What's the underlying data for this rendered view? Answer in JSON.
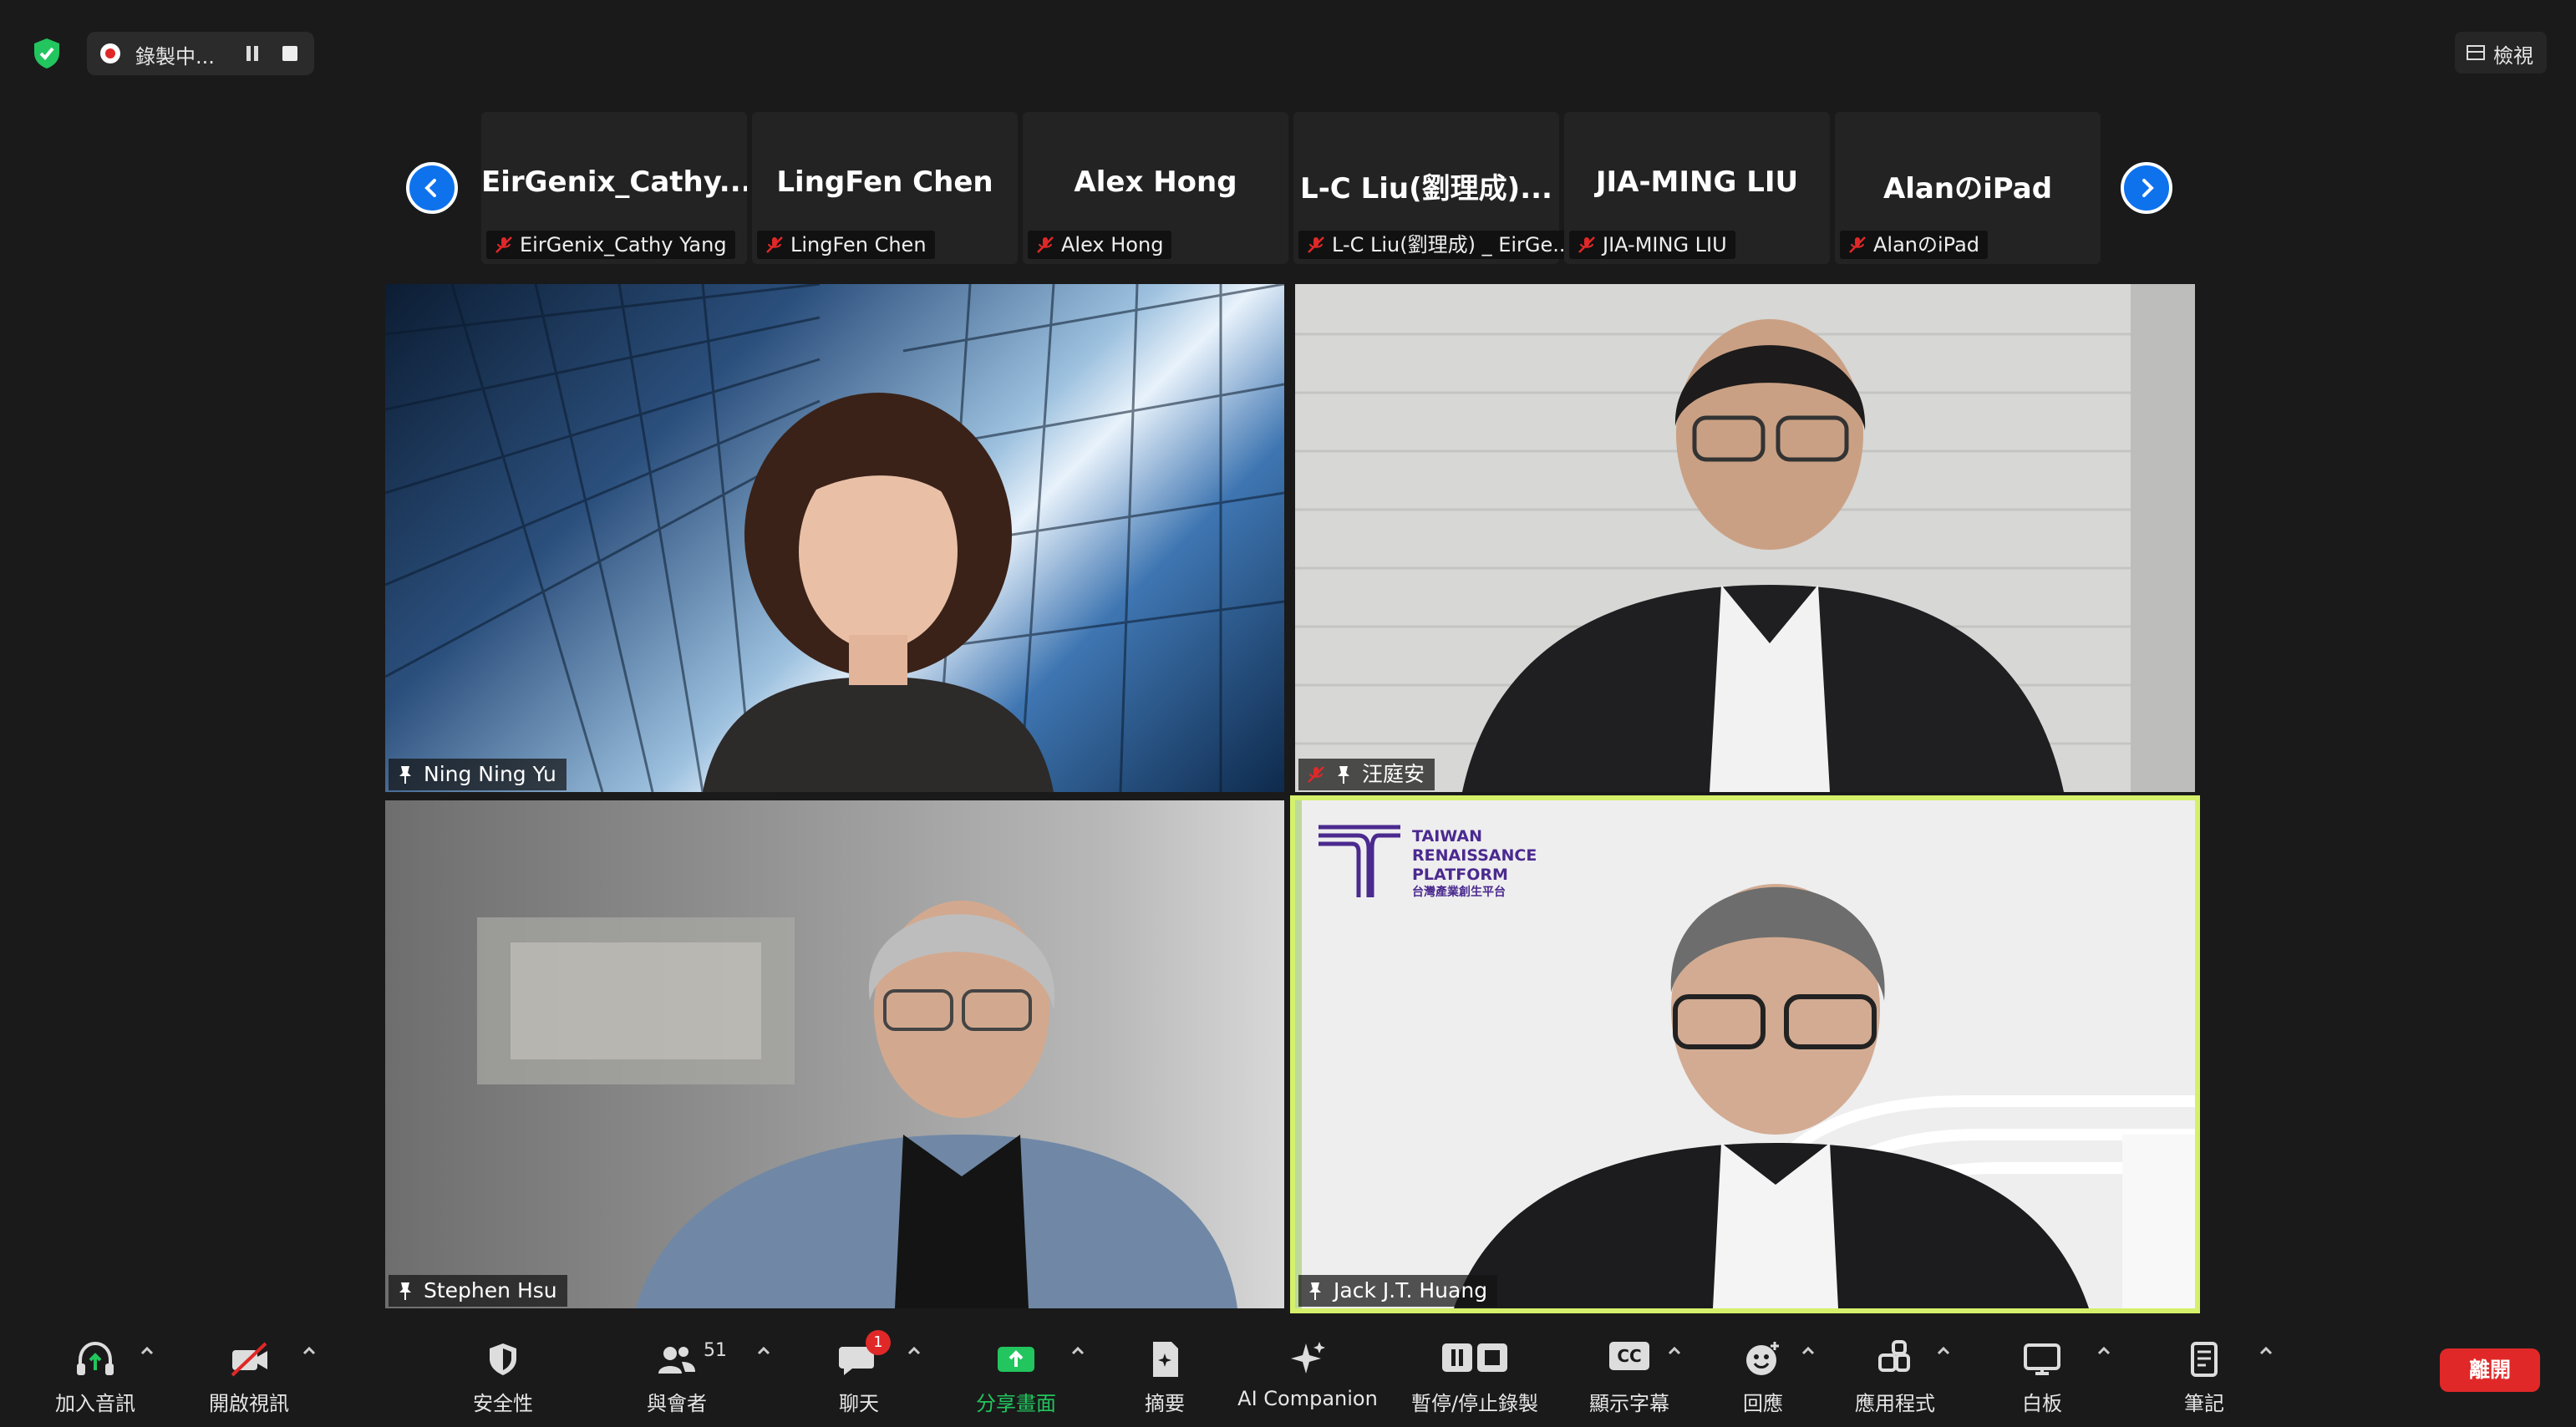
{
  "top_bar": {
    "recording_text": "錄製中...",
    "view_label": "檢視"
  },
  "filmstrip": [
    {
      "display_name": "EirGenix_Cathy...",
      "sub_name": "EirGenix_Cathy Yang"
    },
    {
      "display_name": "LingFen Chen",
      "sub_name": "LingFen Chen"
    },
    {
      "display_name": "Alex Hong",
      "sub_name": "Alex Hong"
    },
    {
      "display_name": "L-C Liu(劉理成)...",
      "sub_name": "L-C Liu(劉理成) _ EirGe..."
    },
    {
      "display_name": "JIA-MING LIU",
      "sub_name": "JIA-MING LIU"
    },
    {
      "display_name": "AlanのiPad",
      "sub_name": "AlanのiPad"
    }
  ],
  "videos": [
    {
      "name": "Ning Ning Yu"
    },
    {
      "name": "汪庭安"
    },
    {
      "name": "Stephen Hsu"
    },
    {
      "name": "Jack J.T. Huang"
    }
  ],
  "platform_logo": {
    "line1": "TAIWAN",
    "line2": "RENAISSANCE",
    "line3": "PLATFORM",
    "line4": "台灣產業創生平台"
  },
  "toolbar": {
    "join_audio": "加入音訊",
    "start_video": "開啟視訊",
    "security": "安全性",
    "participants": "與會者",
    "participants_count": "51",
    "chat": "聊天",
    "chat_badge": "1",
    "share_screen": "分享畫面",
    "summary": "摘要",
    "ai_companion": "AI Companion",
    "pause_stop_recording": "暫停/停止錄製",
    "captions": "顯示字幕",
    "captions_icon_text": "CC",
    "reactions": "回應",
    "apps": "應用程式",
    "whiteboard": "白板",
    "notes": "筆記",
    "leave": "離開"
  },
  "colors": {
    "accent_blue": "#0e72ed",
    "share_green": "#22c55e",
    "leave_red": "#e02828",
    "active_speaker_border": "#d5f06a"
  }
}
